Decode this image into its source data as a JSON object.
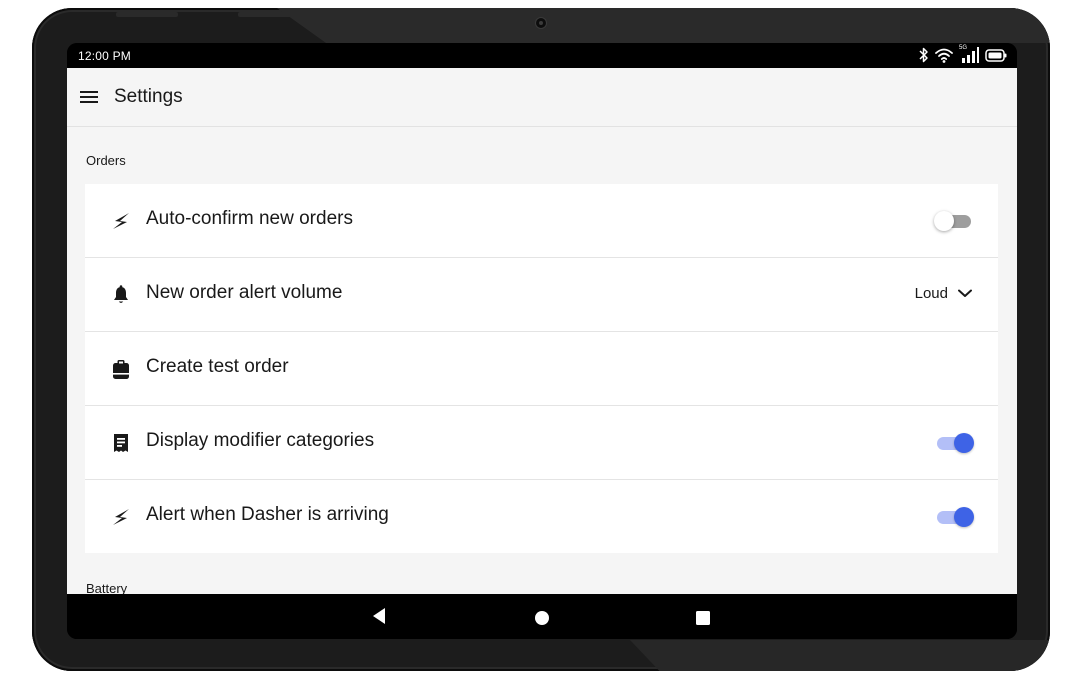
{
  "status_bar": {
    "time": "12:00 PM",
    "icons": [
      "bluetooth-icon",
      "wifi-icon",
      "cellular-5g-icon",
      "battery-icon"
    ],
    "network_label": "5G"
  },
  "app_bar": {
    "menu_icon": "hamburger-menu-icon",
    "title": "Settings"
  },
  "sections": [
    {
      "label": "Orders",
      "items": [
        {
          "icon": "lightning-icon",
          "label": "Auto-confirm new orders",
          "control": "toggle",
          "on": false
        },
        {
          "icon": "bell-icon",
          "label": "New order alert volume",
          "control": "select",
          "value": "Loud"
        },
        {
          "icon": "clipboard-icon",
          "label": "Create test order",
          "control": "none"
        },
        {
          "icon": "receipt-icon",
          "label": "Display modifier categories",
          "control": "toggle",
          "on": true
        },
        {
          "icon": "lightning-icon",
          "label": "Alert when Dasher is arriving",
          "control": "toggle",
          "on": true
        }
      ]
    },
    {
      "label": "Battery",
      "items": []
    }
  ],
  "nav_bar": {
    "buttons": [
      "back-icon",
      "home-icon",
      "recents-icon"
    ]
  },
  "colors": {
    "accent": "#3e63e6",
    "accent_track": "#b3bff7",
    "background": "#f5f5f5",
    "card": "#ffffff",
    "text": "#191919"
  }
}
